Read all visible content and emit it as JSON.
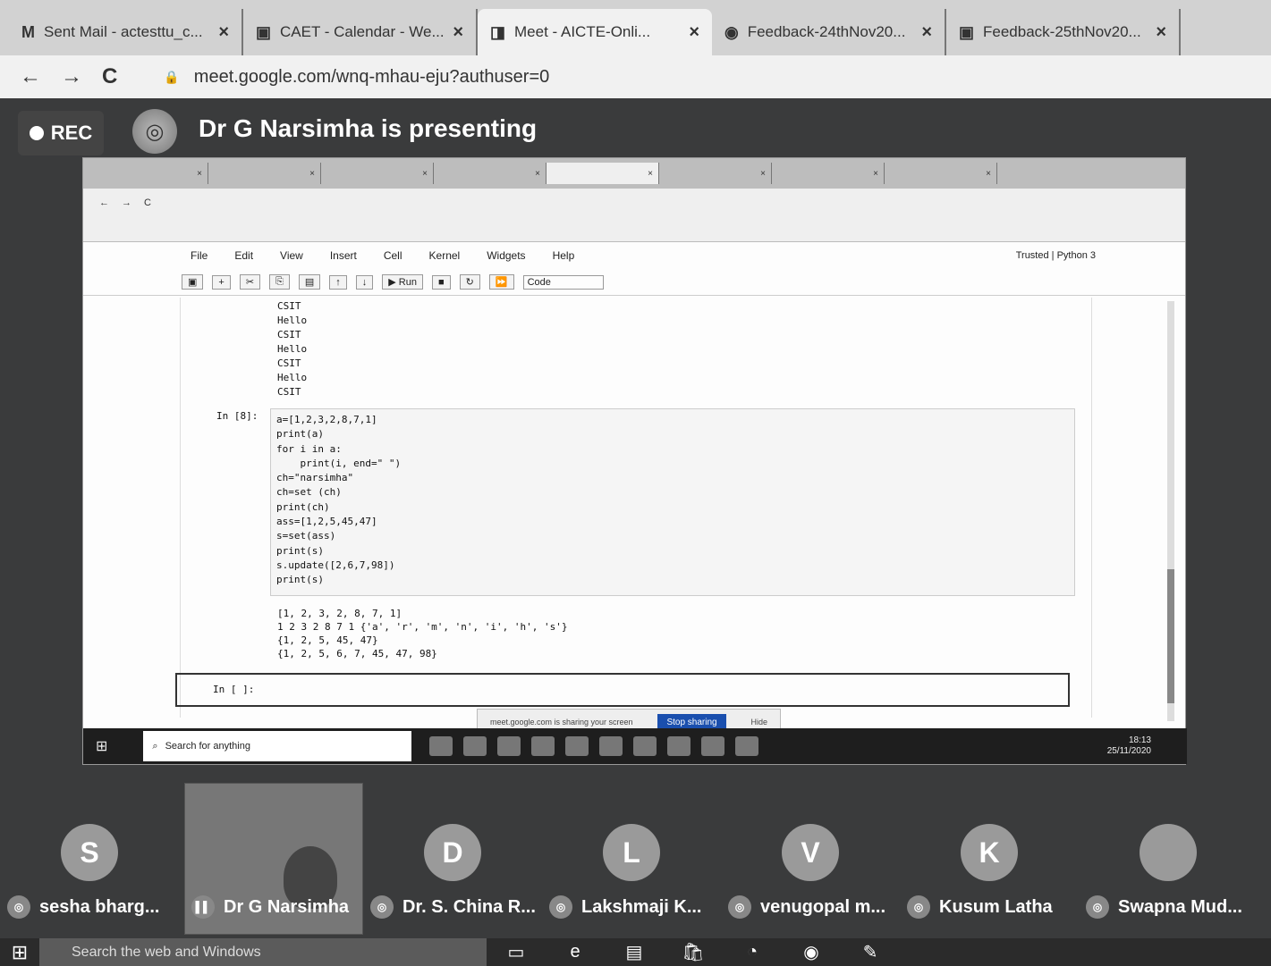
{
  "browser": {
    "tabs": [
      {
        "icon": "M",
        "label": "Sent Mail - actesttu_c...",
        "active": false
      },
      {
        "icon": "▣",
        "label": "CAET - Calendar - We...",
        "active": false
      },
      {
        "icon": "◨",
        "label": "Meet - AICTE-Onli...",
        "active": true
      },
      {
        "icon": "◉",
        "label": "Feedback-24thNov20...",
        "active": false
      },
      {
        "icon": "▣",
        "label": "Feedback-25thNov20...",
        "active": false
      }
    ],
    "url": "meet.google.com/wnq-mhau-eju?authuser=0"
  },
  "meet": {
    "rec_label": "REC",
    "presenting_text": "Dr G Narsimha is presenting",
    "participants": [
      {
        "initial": "S",
        "name": "sesha bharg..."
      },
      {
        "initial": "",
        "name": "Dr G Narsimha"
      },
      {
        "initial": "D",
        "name": "Dr. S. China R..."
      },
      {
        "initial": "L",
        "name": "Lakshmaji K..."
      },
      {
        "initial": "V",
        "name": "venugopal m..."
      },
      {
        "initial": "K",
        "name": "Kusum Latha"
      },
      {
        "initial": "",
        "name": "Swapna Mud..."
      }
    ]
  },
  "shared": {
    "menu": [
      "File",
      "Edit",
      "View",
      "Insert",
      "Cell",
      "Kernel",
      "Widgets",
      "Help"
    ],
    "kernel_label": "Trusted  |  Python 3",
    "cell_type": "Code",
    "run_label": "Run",
    "out1": "CSIT\nHello\nCSIT\nHello\nCSIT\nHello\nCSIT",
    "prompt": "In [8]:",
    "code": "a=[1,2,3,2,8,7,1]\nprint(a)\nfor i in a:\n    print(i, end=\" \")\nch=\"narsimha\"\nch=set (ch)\nprint(ch)\nass=[1,2,5,45,47]\ns=set(ass)\nprint(s)\ns.update([2,6,7,98])\nprint(s)",
    "out2": "[1, 2, 3, 2, 8, 7, 1]\n1 2 3 2 8 7 1 {'a', 'r', 'm', 'n', 'i', 'h', 's'}\n{1, 2, 5, 45, 47}\n{1, 2, 5, 6, 7, 45, 47, 98}",
    "new_prompt": "In [ ]:",
    "share_notice": "meet.google.com is sharing your screen",
    "stop_label": "Stop sharing",
    "hide_label": "Hide",
    "search_placeholder": "Search for anything",
    "clock": "18:13\n25/11/2020"
  },
  "taskbar": {
    "search_placeholder": "Search the web and Windows"
  }
}
